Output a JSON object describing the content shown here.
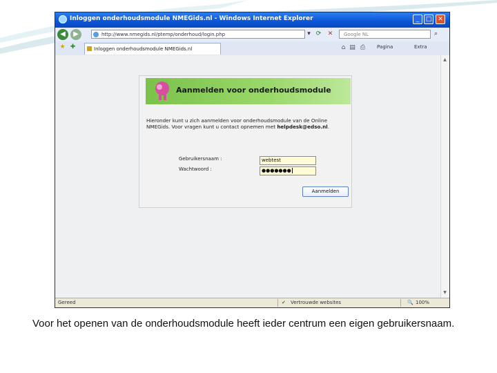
{
  "window": {
    "title": "Inloggen onderhoudsmodule NMEGids.nl - Windows Internet Explorer",
    "minimize": "_",
    "maximize": "□",
    "close": "✕"
  },
  "address_bar": {
    "url": "http://www.nmegids.nl/ptemp/onderhoud/login.php",
    "search_placeholder": "Google NL"
  },
  "tab": {
    "label": "Inloggen onderhoudsmodule NMEGids.nl"
  },
  "toolbar": {
    "pagina_label": "Pagina",
    "extra_label": "Extra"
  },
  "page": {
    "banner_title": "Aanmelden voor onderhoudsmodule",
    "description_prefix": "Hieronder kunt u zich aanmelden voor onderhoudsmodule van de Online NMEGids. Voor vragen kunt u contact opnemen met",
    "description_email": "helpdesk@edso.nl",
    "description_suffix": ".",
    "username_label": "Gebruikersnaam :",
    "password_label": "Wachtwoord :",
    "username_value": "webtest",
    "password_value": "●●●●●●●",
    "submit_label": "Aanmelden"
  },
  "status_bar": {
    "status": "Gereed",
    "zone": "Vertrouwde websites",
    "zoom": "100%"
  },
  "caption": "Voor het openen van de onderhoudsmodule heeft ieder centrum een eigen gebruikersnaam.",
  "colors": {
    "titlebar": "#0b55d6",
    "banner": "#7ac24a",
    "input_bg": "#fffbd6"
  }
}
